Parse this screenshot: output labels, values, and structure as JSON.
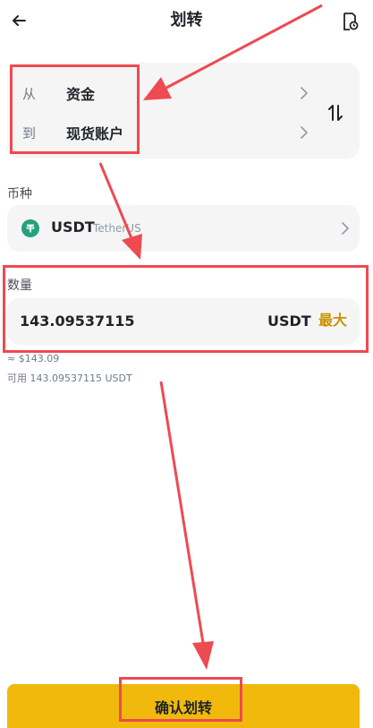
{
  "header": {
    "title": "划转",
    "back_icon": "arrow-left-icon",
    "history_icon": "transfer-history-icon"
  },
  "transfer": {
    "from_label": "从",
    "from_value": "资金",
    "to_label": "到",
    "to_value": "现货账户",
    "swap_icon": "swap-vertical-icon"
  },
  "coin": {
    "section_label": "币种",
    "symbol": "USDT",
    "name": "TetherUS"
  },
  "amount": {
    "section_label": "数量",
    "value": "143.09537115",
    "unit": "USDT",
    "max_label": "最大",
    "approx": "≈ $143.09",
    "available": "可用 143.09537115 USDT"
  },
  "confirm_label": "确认划转",
  "colors": {
    "accent": "#f0b90b",
    "max_text": "#c99400",
    "annotation": "#ee4a51",
    "usdt": "#26a17b"
  }
}
